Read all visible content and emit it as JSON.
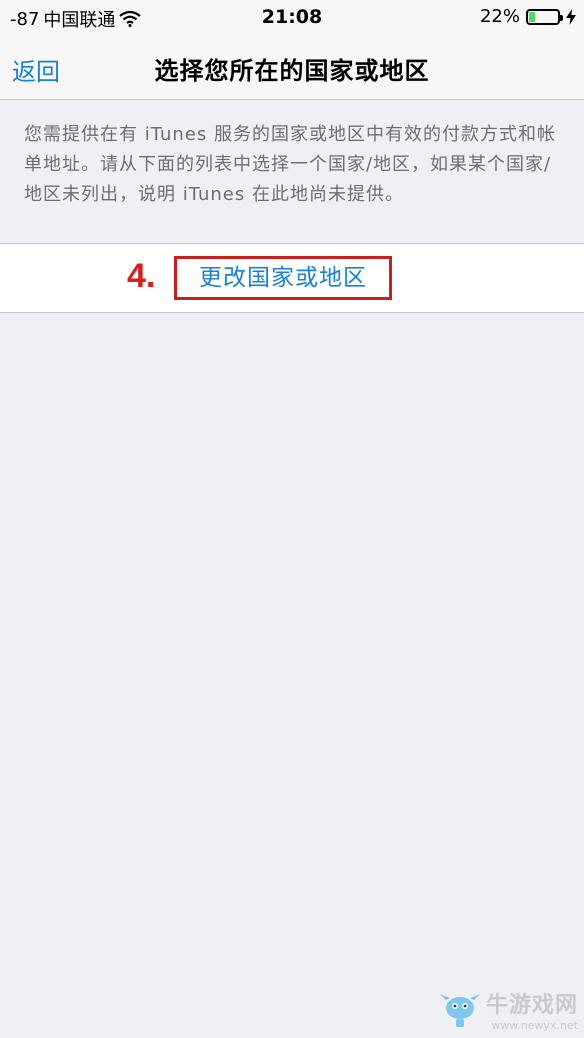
{
  "status_bar": {
    "signal": "-87",
    "carrier": "中国联通",
    "time": "21:08",
    "battery_percent": "22%",
    "battery_level": 0.22,
    "battery_color": "#4cd964"
  },
  "nav": {
    "back_label": "返回",
    "title": "选择您所在的国家或地区"
  },
  "description": "您需提供在有 iTunes 服务的国家或地区中有效的付款方式和帐单地址。请从下面的列表中选择一个国家/地区，如果某个国家/地区未列出，说明 iTunes 在此地尚未提供。",
  "action": {
    "step_label": "4.",
    "button_label": "更改国家或地区"
  },
  "watermark": {
    "name": "牛游戏网",
    "url": "www.newyx.net"
  },
  "colors": {
    "accent": "#1a7fd6",
    "highlight": "#c8201e"
  },
  "icons": [
    "wifi-icon",
    "battery-icon",
    "charging-icon",
    "watermark-logo"
  ]
}
